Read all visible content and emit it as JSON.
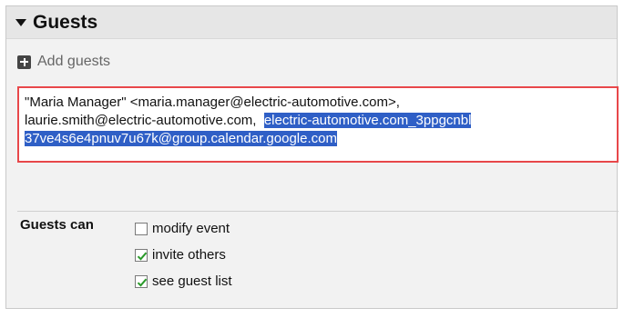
{
  "section": {
    "title": "Guests"
  },
  "add_guests": {
    "label": "Add guests",
    "icon": "plus-box-icon"
  },
  "guest_field": {
    "lines": [
      "\"Maria Manager\" <maria.manager@electric-automotive.com>,",
      "laurie.smith@electric-automotive.com,",
      "electric-automotive.com_3ppgcnbl",
      "37ve4s6e4pnuv7u67k@group.calendar.google.com"
    ],
    "highlight_color": "#2f5fc6",
    "border_color": "#e8474a"
  },
  "permissions": {
    "label": "Guests can",
    "options": [
      {
        "label": "modify event",
        "checked": false
      },
      {
        "label": "invite others",
        "checked": true
      },
      {
        "label": "see guest list",
        "checked": true
      }
    ],
    "check_color": "#2a9a2a"
  }
}
